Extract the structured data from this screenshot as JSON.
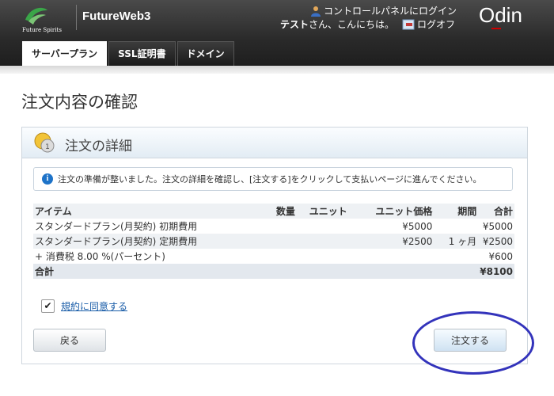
{
  "header": {
    "brand_tagline": "Future Spirits",
    "app_name": "FutureWeb3",
    "control_panel_login": "コントロールパネルにログイン",
    "user_name": "テスト",
    "greeting_suffix": "さん、こんにちは。",
    "logoff": "ログオフ",
    "product_logo": "Odin",
    "colors": {
      "header_bg": "#2a2a2a",
      "logo_green": "#3aa548"
    }
  },
  "tabs": [
    {
      "label": "サーバープラン",
      "active": true
    },
    {
      "label": "SSL証明書",
      "active": false
    },
    {
      "label": "ドメイン",
      "active": false
    }
  ],
  "page": {
    "title": "注文内容の確認",
    "panel_title": "注文の詳細",
    "info_message": "注文の準備が整いました。注文の詳細を確認し、[注文する]をクリックして支払いページに進んでください。"
  },
  "table": {
    "headers": {
      "item": "アイテム",
      "quantity": "数量",
      "unit": "ユニット",
      "unit_price": "ユニット価格",
      "period": "期間",
      "total": "合計"
    },
    "rows": [
      {
        "item": "スタンダードプラン(月契約) 初期費用",
        "quantity": "",
        "unit": "",
        "unit_price": "¥5000",
        "period": "",
        "total": "¥5000"
      },
      {
        "item": "スタンダードプラン(月契約) 定期費用",
        "quantity": "",
        "unit": "",
        "unit_price": "¥2500",
        "period": "1 ヶ月",
        "total": "¥2500"
      },
      {
        "item": "+ 消費税 8.00 %(パーセント)",
        "quantity": "",
        "unit": "",
        "unit_price": "",
        "period": "",
        "total": "¥600"
      }
    ],
    "grand_total_label": "合計",
    "grand_total_value": "¥8100"
  },
  "agreement": {
    "checked": true,
    "check_mark": "✔",
    "link_label": "規約に同意する"
  },
  "buttons": {
    "back": "戻る",
    "order": "注文する"
  }
}
